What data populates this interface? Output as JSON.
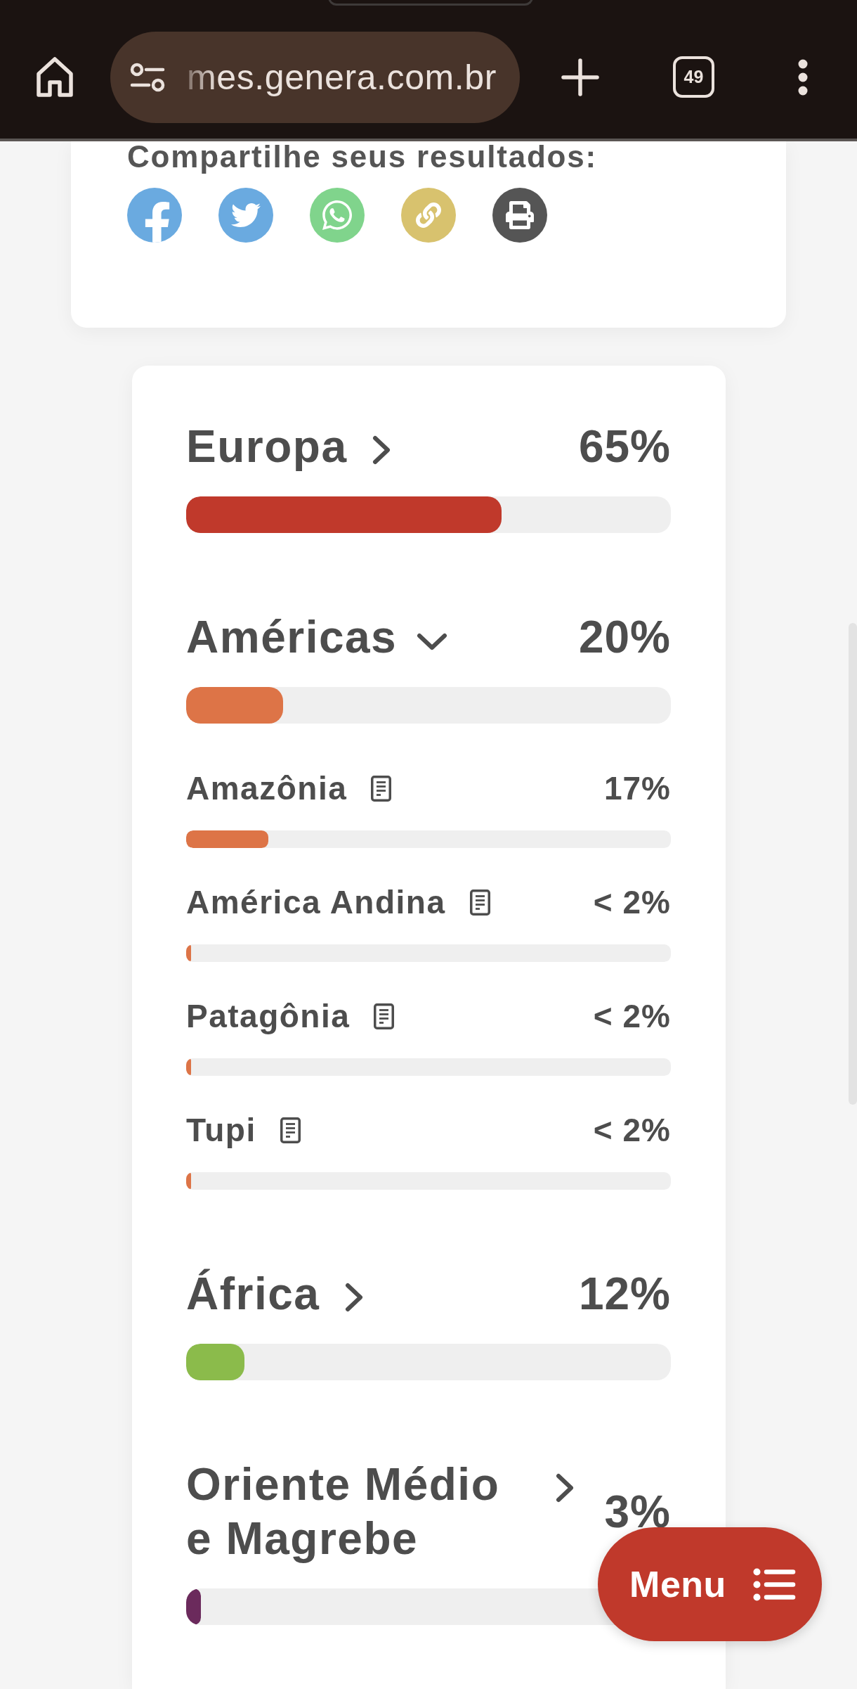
{
  "browser": {
    "url": "mes.genera.com.br",
    "tab_count": "49"
  },
  "share": {
    "title": "Compartilhe seus resultados:",
    "buttons": [
      {
        "kind": "facebook",
        "color": "#6aaae0"
      },
      {
        "kind": "twitter",
        "color": "#6aaae0"
      },
      {
        "kind": "whatsapp",
        "color": "#80d48c"
      },
      {
        "kind": "link",
        "color": "#d8c26e"
      },
      {
        "kind": "print",
        "color": "#555555"
      }
    ]
  },
  "regions": [
    {
      "name": "Europa",
      "percent": "65%",
      "level": 0.65,
      "color": "#c0392b",
      "expanded": false
    },
    {
      "name": "Américas",
      "percent": "20%",
      "level": 0.2,
      "color": "#dd7447",
      "expanded": true,
      "children": [
        {
          "name": "Amazônia",
          "percent": "17%",
          "level": 0.17
        },
        {
          "name": "América Andina",
          "percent": "< 2%",
          "level": 0.01
        },
        {
          "name": "Patagônia",
          "percent": "< 2%",
          "level": 0.01
        },
        {
          "name": "Tupi",
          "percent": "< 2%",
          "level": 0.01
        }
      ]
    },
    {
      "name": "África",
      "percent": "12%",
      "level": 0.12,
      "color": "#8bbb4b",
      "expanded": false
    },
    {
      "name": "Oriente Médio e Magrebe",
      "percent": "3%",
      "level": 0.03,
      "color": "#6b2a5c",
      "expanded": false
    }
  ],
  "menu_button": {
    "label": "Menu"
  }
}
